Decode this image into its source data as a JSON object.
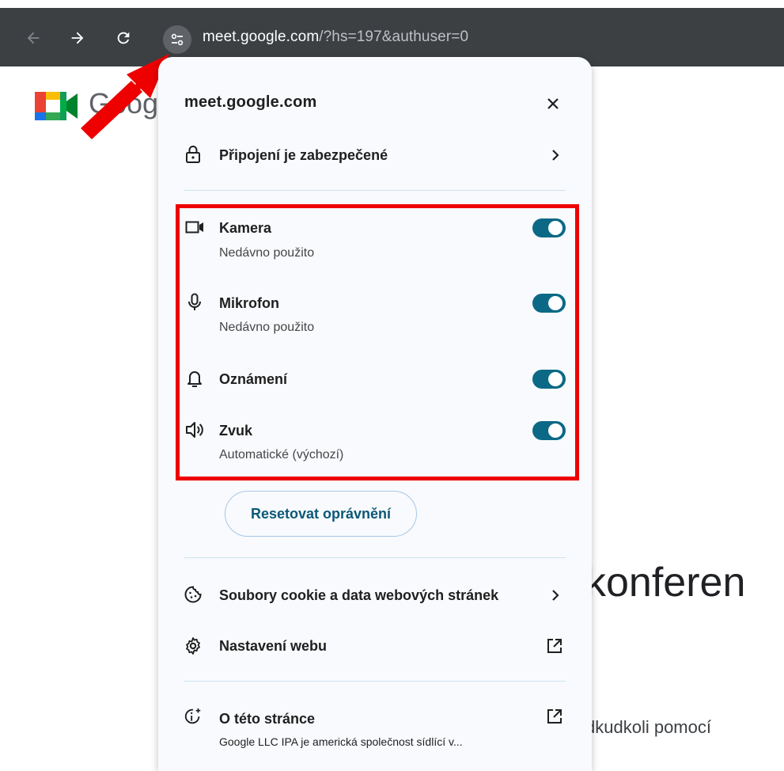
{
  "browser": {
    "url_host": "meet.google.com",
    "url_path": "/?hs=197&authuser=0"
  },
  "background_page": {
    "google_text": "Goog",
    "headline_fragment": "konferen",
    "subtext_fragment": "dkudkoli pomocí"
  },
  "popup": {
    "title": "meet.google.com",
    "connection_label": "Připojení je zabezpečené",
    "permissions": [
      {
        "label": "Kamera",
        "sub": "Nedávno použito",
        "icon": "camera-icon",
        "enabled": true
      },
      {
        "label": "Mikrofon",
        "sub": "Nedávno použito",
        "icon": "microphone-icon",
        "enabled": true
      },
      {
        "label": "Oznámení",
        "sub": "",
        "icon": "bell-icon",
        "enabled": true
      },
      {
        "label": "Zvuk",
        "sub": "Automatické (výchozí)",
        "icon": "speaker-icon",
        "enabled": true
      }
    ],
    "reset_label": "Resetovat oprávnění",
    "cookies_label": "Soubory cookie a data webových stránek",
    "site_settings_label": "Nastavení webu",
    "about_label": "O této stránce",
    "about_sub": "Google LLC IPA je americká společnost sídlící v..."
  },
  "colors": {
    "toggle_on": "#0b6985",
    "highlight": "#ee0000",
    "toolbar": "#3c4043"
  }
}
